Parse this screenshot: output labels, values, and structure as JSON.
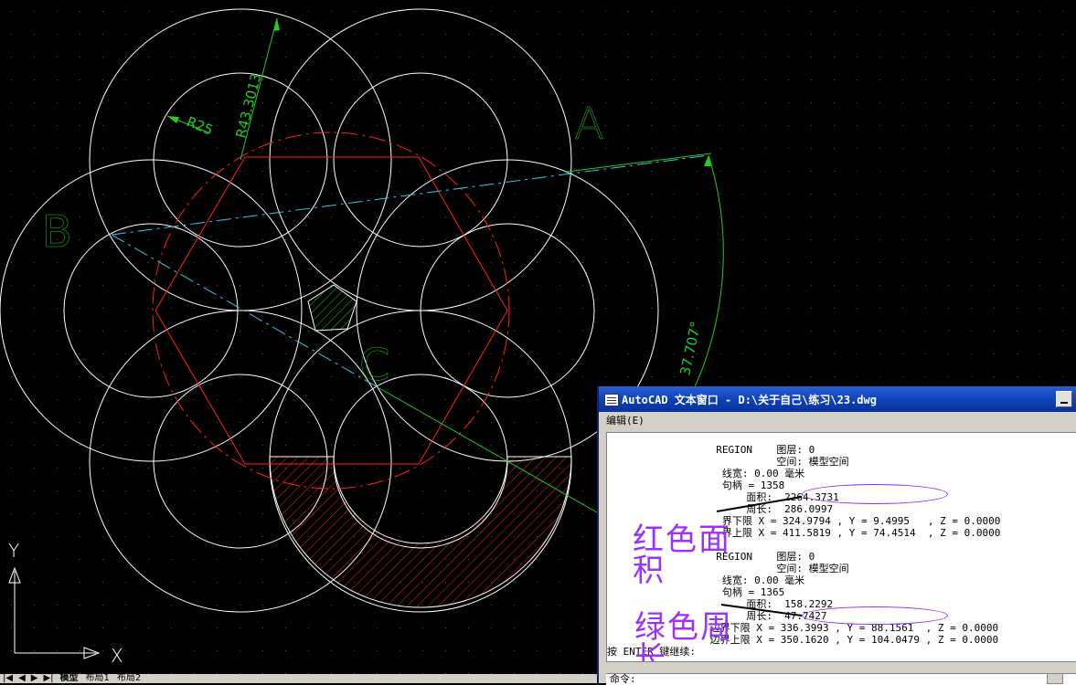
{
  "drawing": {
    "labels": {
      "a": "A",
      "b": "B",
      "c": "C"
    },
    "dimensions": {
      "radius_large": "R43.3013",
      "radius_small": "R25",
      "angle": "37.707°"
    },
    "ucs": {
      "x": "X",
      "y": "Y"
    },
    "colors": {
      "background": "#000000",
      "white_lines": "#ffffff",
      "red": "#ff2020",
      "green": "#22cc22",
      "cyan": "#33c8e8",
      "purple": "#9b30ff"
    }
  },
  "layout_tabs": {
    "nav": [
      "|◀",
      "◀",
      "▶",
      "▶|"
    ],
    "tabs": [
      "模型",
      "布局1",
      "布局2"
    ]
  },
  "text_window": {
    "title": "AutoCAD 文本窗口 - D:\\关于自己\\练习\\23.dwg",
    "menu_edit": "编辑(E)",
    "lines": [
      "                  REGION    图层: 0",
      "                            空间: 模型空间",
      "                   线宽: 0.00 毫米",
      "                   句柄 = 1358",
      "                       面积:  2264.3731",
      "                       周长:  286.0997",
      "                   界下限 X = 324.9794 , Y = 9.4995   , Z = 0.0000",
      "                   界上限 X = 411.5819 , Y = 74.4514  , Z = 0.0000",
      "",
      "                  REGION    图层: 0",
      "                            空间: 模型空间",
      "                   线宽: 0.00 毫米",
      "                   句柄 = 1365",
      "                       面积:  158.2292",
      "                       周长:  47.7427",
      "                 边界下限 X = 336.3993 , Y = 88.1561  , Z = 0.0000",
      "                 边界上限 X = 350.1620 , Y = 104.0479 , Z = 0.0000",
      "按 ENTER 键继续:"
    ],
    "annotation_red": "红色面积",
    "annotation_green": "绿色周长",
    "command_label": "命令:"
  }
}
